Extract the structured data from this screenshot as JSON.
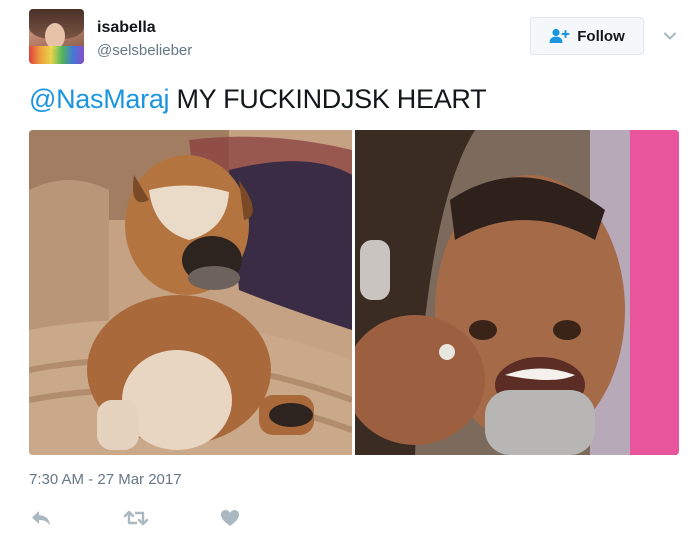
{
  "user": {
    "display_name": "isabella",
    "handle": "@selsbelieber"
  },
  "follow_button": {
    "label": "Follow",
    "icon": "add-person-icon"
  },
  "menu_icon": "chevron-down-icon",
  "tweet": {
    "mention": "@NasMaraj",
    "text": " MY FUCKINDJSK HEART",
    "timestamp": "7:30 AM - 27 Mar 2017"
  },
  "actions": [
    {
      "name": "reply",
      "icon": "reply-icon"
    },
    {
      "name": "retweet",
      "icon": "retweet-icon"
    },
    {
      "name": "like",
      "icon": "heart-icon"
    }
  ],
  "colors": {
    "link": "#1b95e0",
    "text": "#14171a",
    "muted": "#657786",
    "icon": "#aab8c2"
  }
}
